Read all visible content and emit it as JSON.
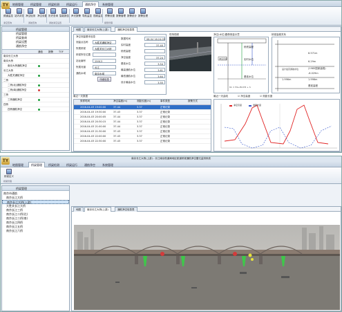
{
  "top": {
    "logo": "TY",
    "tabs": [
      "地图管理",
      "桥梁管理",
      "桥梁检测",
      "桥梁运行",
      "通航净空",
      "系统管理"
    ],
    "active_tab": 4,
    "ribbon_buttons": [
      "频道监控",
      "站内浏览",
      "净空检测",
      "净空设置",
      "历史查询",
      "智能报告",
      "声光报警",
      "导航监控",
      "视频监控",
      "预警设置",
      "报警管理",
      "报警统计",
      "报警处理"
    ],
    "group_labels": [
      "净空查询",
      "通航查询",
      "通航净空设置",
      "报警管理"
    ],
    "sidebar": {
      "header": "桥梁管理",
      "items": [
        "桥梁管理",
        "桥梁查询",
        "桥梁设置",
        "通航净空"
      ]
    },
    "device_table": {
      "headers": [
        "",
        "通信",
        "报警",
        "TOF"
      ],
      "rows": [
        {
          "name": "南京长江大桥",
          "status": ""
        },
        {
          "name": "南京大桥",
          "status": ""
        },
        {
          "name": "南京大桥通航净空",
          "status": "green"
        },
        {
          "name": "长江大桥",
          "status": ""
        },
        {
          "name": "大胜关通航净空",
          "status": "green"
        },
        {
          "name": "二桥",
          "status": ""
        },
        {
          "name": "二桥(北)通航净空",
          "status": "green"
        },
        {
          "name": "二桥(南)通航净空",
          "status": "red"
        },
        {
          "name": "三桥",
          "status": ""
        },
        {
          "name": "三桥通航净空",
          "status": "green"
        },
        {
          "name": "四桥",
          "status": ""
        },
        {
          "name": "四桥通航净空",
          "status": "green"
        }
      ]
    },
    "panel_tabs": [
      "地图",
      "南京长江大桥(上游)",
      "通航净空信息表"
    ],
    "info_title": "净空测量基本信息",
    "fields": [
      {
        "label": "测量点名称",
        "value": "大胜关通航净空"
      },
      {
        "label": "所属桥梁",
        "value": "大胜关长江大桥"
      },
      {
        "label": "桥梁所在位置",
        "value": ""
      },
      {
        "label": "站址编号",
        "value": "25913"
      },
      {
        "label": "所属河道",
        "value": "长江"
      },
      {
        "label": "通航水域",
        "value": "南京水域"
      }
    ],
    "detail_button": "详细信息",
    "measure_labels": [
      "数据时间",
      "实时高度",
      "桥底高程",
      "净空高度",
      "基准水位",
      "最高通航水位",
      "最低通航水位",
      "设计最高水位"
    ],
    "measure_values": [
      "08-04 16:24:05",
      "37.40",
      "",
      "37.24",
      "3.54",
      "3.61",
      "3.64",
      "3.55"
    ],
    "video_title": "现场视频",
    "diagram_title": "净空(水位)图像测量示意",
    "diagram_labels": [
      "桥底高程",
      "实时水位",
      "净空高度",
      "基准水位"
    ],
    "diagram_formula": "h1 = H1+H2-H3 + h",
    "elevation_title": "桥梁高程关系",
    "elevation_values": [
      "8.571m",
      "6.29m",
      "(1985国家高程)",
      "-8.029m",
      "1.996m",
      "1.996m"
    ],
    "elevation_sub": "设计最高通航水位",
    "elevation_bottom": "基准高程",
    "list_title": "最近一天数据",
    "list_headers": [
      "",
      "采样时间",
      "净空高度(m)",
      "测距长度(m)",
      "事件类型",
      "报警方式"
    ],
    "list_rows": [
      [
        "2016-04-03 19:00:00",
        "37.44",
        "3.37",
        "正常记录",
        ""
      ],
      [
        "2016-04-03 19:30:00",
        "37.43",
        "3.37",
        "正常记录",
        ""
      ],
      [
        "2016-04-03 20:00:05",
        "37.44",
        "3.37",
        "正常记录",
        ""
      ],
      [
        "2016-04-03 20:30:15",
        "37.44",
        "3.37",
        "正常记录",
        ""
      ],
      [
        "2016-04-03 21:00:00",
        "37.44",
        "3.37",
        "正常记录",
        ""
      ],
      [
        "2016-04-03 21:30:00",
        "37.43",
        "3.37",
        "正常记录",
        ""
      ],
      [
        "2016-04-03 22:00:00",
        "37.43",
        "3.37",
        "正常记录",
        ""
      ],
      [
        "2016-04-03 22:30:00",
        "37.43",
        "3.37",
        "正常记录",
        ""
      ]
    ],
    "curve_title": "最近一天曲线",
    "curve_checks": [
      "净空高度",
      "测距长度"
    ],
    "curve_legend": [
      "净空高度",
      "测距长度"
    ]
  },
  "bottom": {
    "logo": "TY",
    "title": "南京长江大桥(上游) - 长江南京航道局地区航道桥梁通航净空雷达监测系统",
    "tabs": [
      "地图管理",
      "桥梁管理",
      "桥梁检测",
      "桥梁运行",
      "通航净空",
      "系统管理"
    ],
    "active_tab": 1,
    "ribbon_buttons": [
      "桥梁定义"
    ],
    "group_label": "桥梁管理",
    "sidebar": {
      "header": "桥梁管理",
      "items": [
        "南京市通航",
        "南京长江大桥",
        "南京长江大桥(上游)",
        "大胜关长江大桥",
        "南京长江三桥",
        "南京长江二桥(北)",
        "南京长江二桥(南)",
        "南京长江四桥",
        "南京长江五桥",
        "南京长江六桥"
      ],
      "selected": 2
    },
    "panel_tabs": [
      "地图",
      "南京长江大桥(上游)",
      "通航净空信息表"
    ],
    "colors": {
      "accent": "#2f6fc7",
      "alarm_red": "#d43a3a",
      "ok_green": "#1c9d3a",
      "chart_red": "#e02020",
      "chart_blue": "#3355cc"
    }
  }
}
